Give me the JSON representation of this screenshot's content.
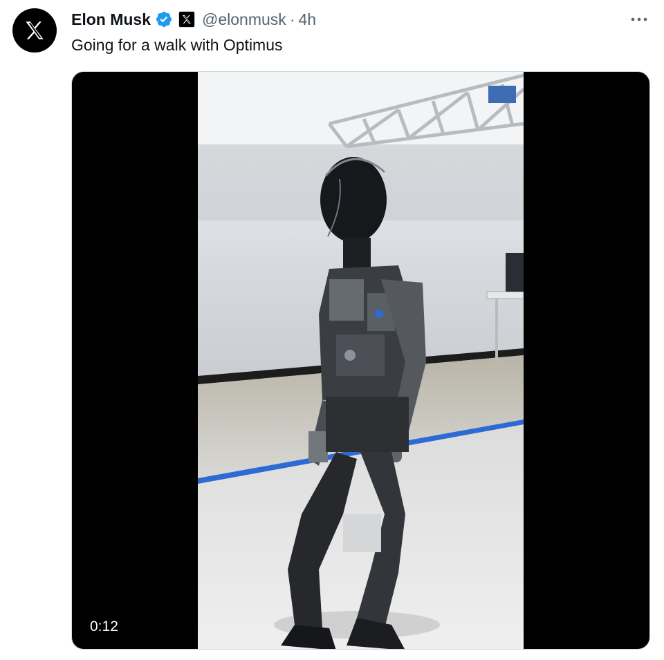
{
  "tweet": {
    "author": {
      "display_name": "Elon Musk",
      "handle": "@elonmusk",
      "verified": true,
      "avatar_icon": "x-logo-icon",
      "affiliate_icon": "x-affiliate-badge-icon"
    },
    "separator": "·",
    "timestamp": "4h",
    "text": "Going for a walk with Optimus",
    "more_icon": "more-options-icon",
    "media": {
      "type": "video",
      "duration": "0:12",
      "subject": "humanoid robot walking"
    }
  },
  "colors": {
    "text_primary": "#0f1419",
    "text_secondary": "#536471",
    "verified_blue": "#1d9bf0",
    "media_background": "#000000"
  }
}
